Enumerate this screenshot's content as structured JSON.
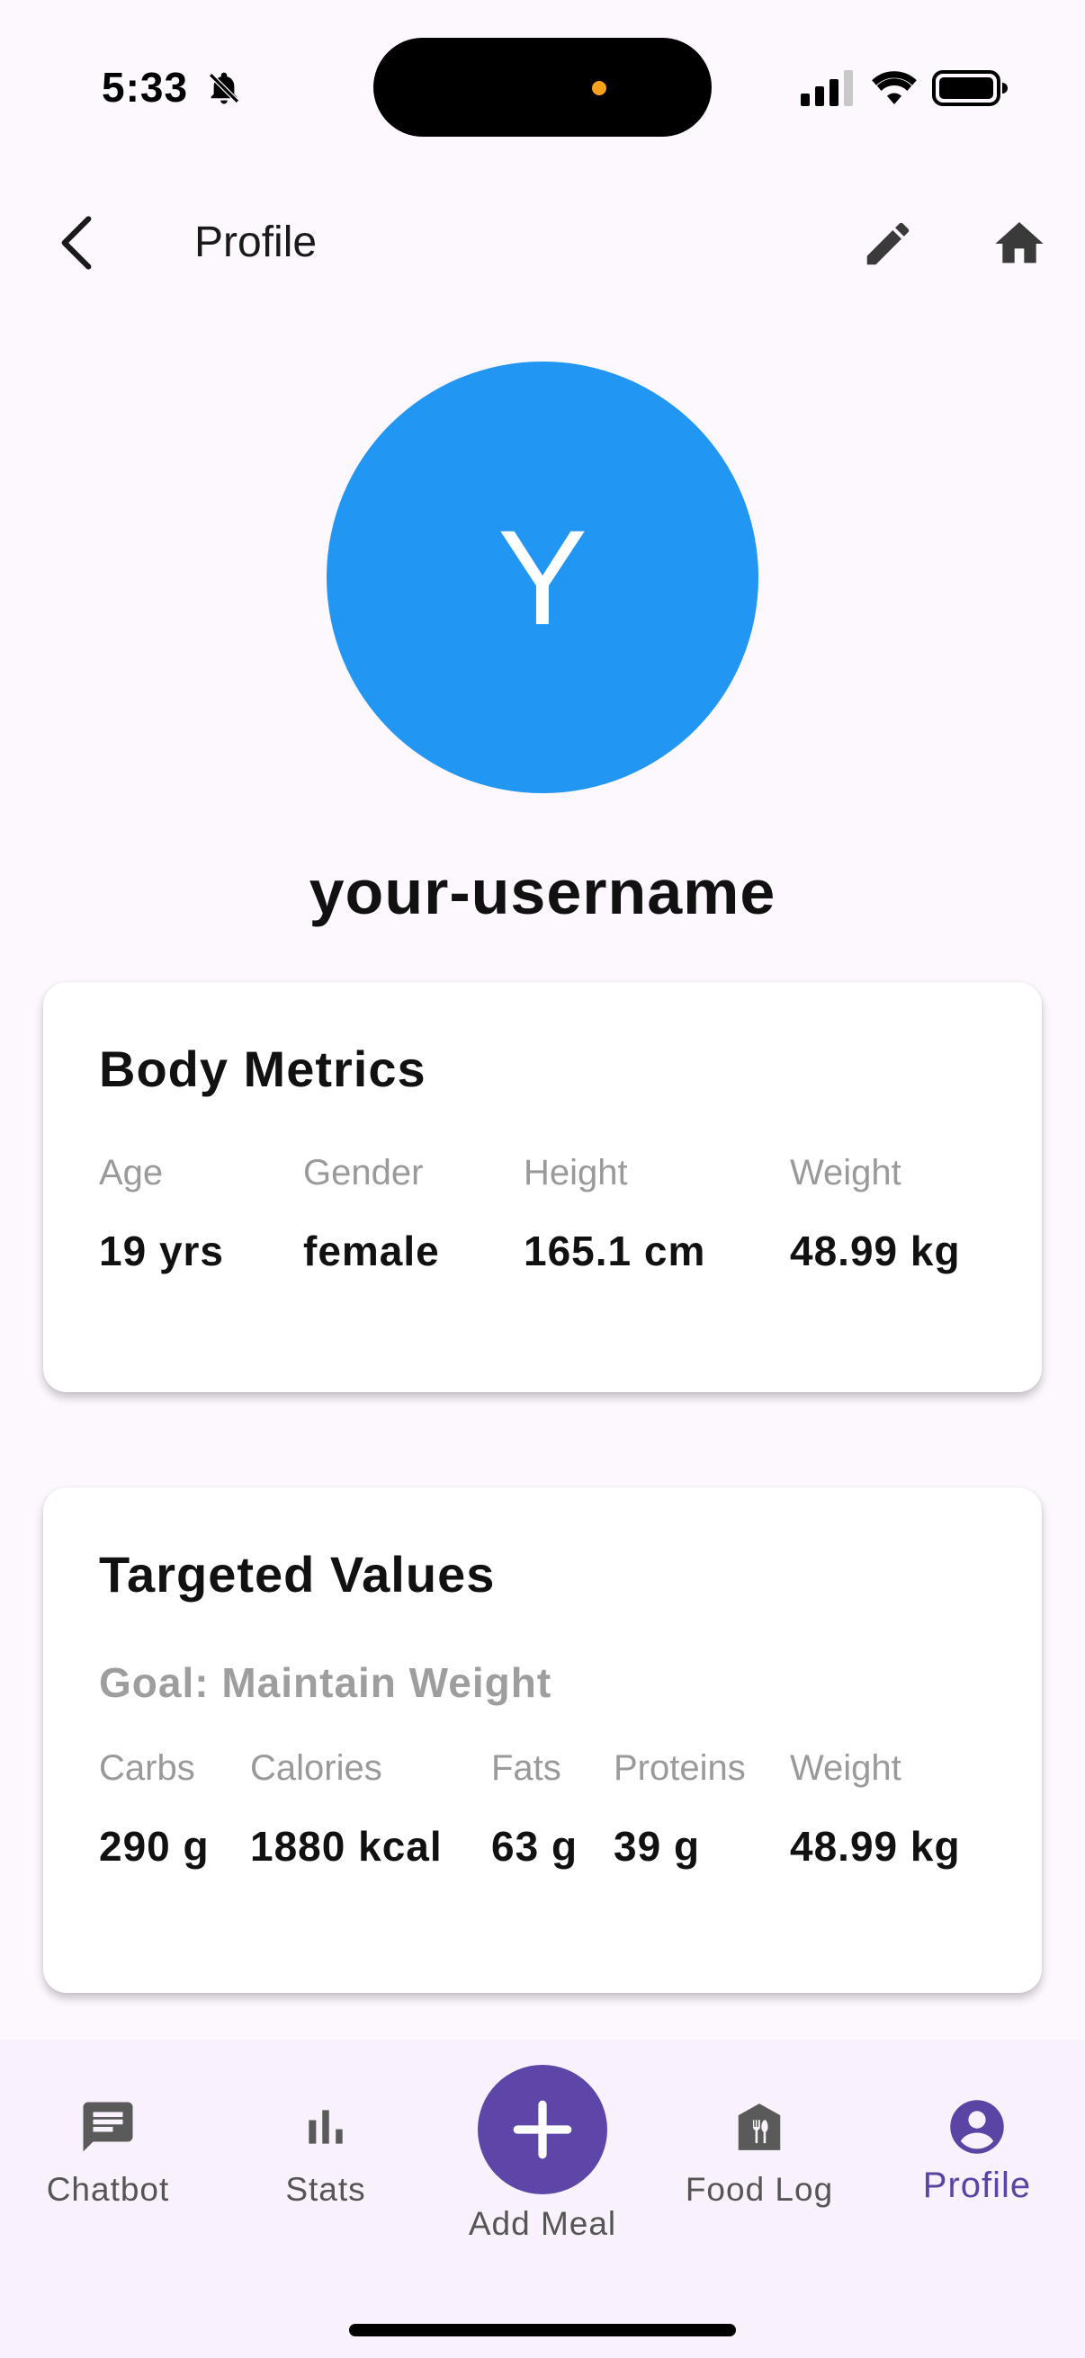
{
  "status_bar": {
    "time": "5:33",
    "icons": [
      "bell-slash-icon",
      "cellular-signal-icon",
      "wifi-icon",
      "battery-icon"
    ]
  },
  "app_bar": {
    "title": "Profile",
    "back_icon": "chevron-left-icon",
    "edit_icon": "pencil-icon",
    "home_icon": "home-icon"
  },
  "profile": {
    "avatar_letter": "Y",
    "avatar_color": "#2196f3",
    "username": "your-username"
  },
  "body_metrics": {
    "title": "Body Metrics",
    "items": [
      {
        "label": "Age",
        "value": "19 yrs"
      },
      {
        "label": "Gender",
        "value": "female"
      },
      {
        "label": "Height",
        "value": "165.1 cm"
      },
      {
        "label": "Weight",
        "value": "48.99 kg"
      }
    ]
  },
  "targeted_values": {
    "title": "Targeted Values",
    "goal": "Goal: Maintain Weight",
    "items": [
      {
        "label": "Carbs",
        "value": "290 g"
      },
      {
        "label": "Calories",
        "value": "1880 kcal"
      },
      {
        "label": "Fats",
        "value": "63 g"
      },
      {
        "label": "Proteins",
        "value": "39 g"
      },
      {
        "label": "Weight",
        "value": "48.99 kg"
      }
    ]
  },
  "bottom_nav": {
    "items": [
      {
        "label": "Chatbot",
        "icon": "chat-icon"
      },
      {
        "label": "Stats",
        "icon": "bar-chart-icon"
      },
      {
        "label": "Add Meal",
        "icon": "plus-icon"
      },
      {
        "label": "Food Log",
        "icon": "food-log-icon"
      },
      {
        "label": "Profile",
        "icon": "account-circle-icon"
      }
    ],
    "active": "Profile",
    "accent_color": "#5e46a8"
  }
}
